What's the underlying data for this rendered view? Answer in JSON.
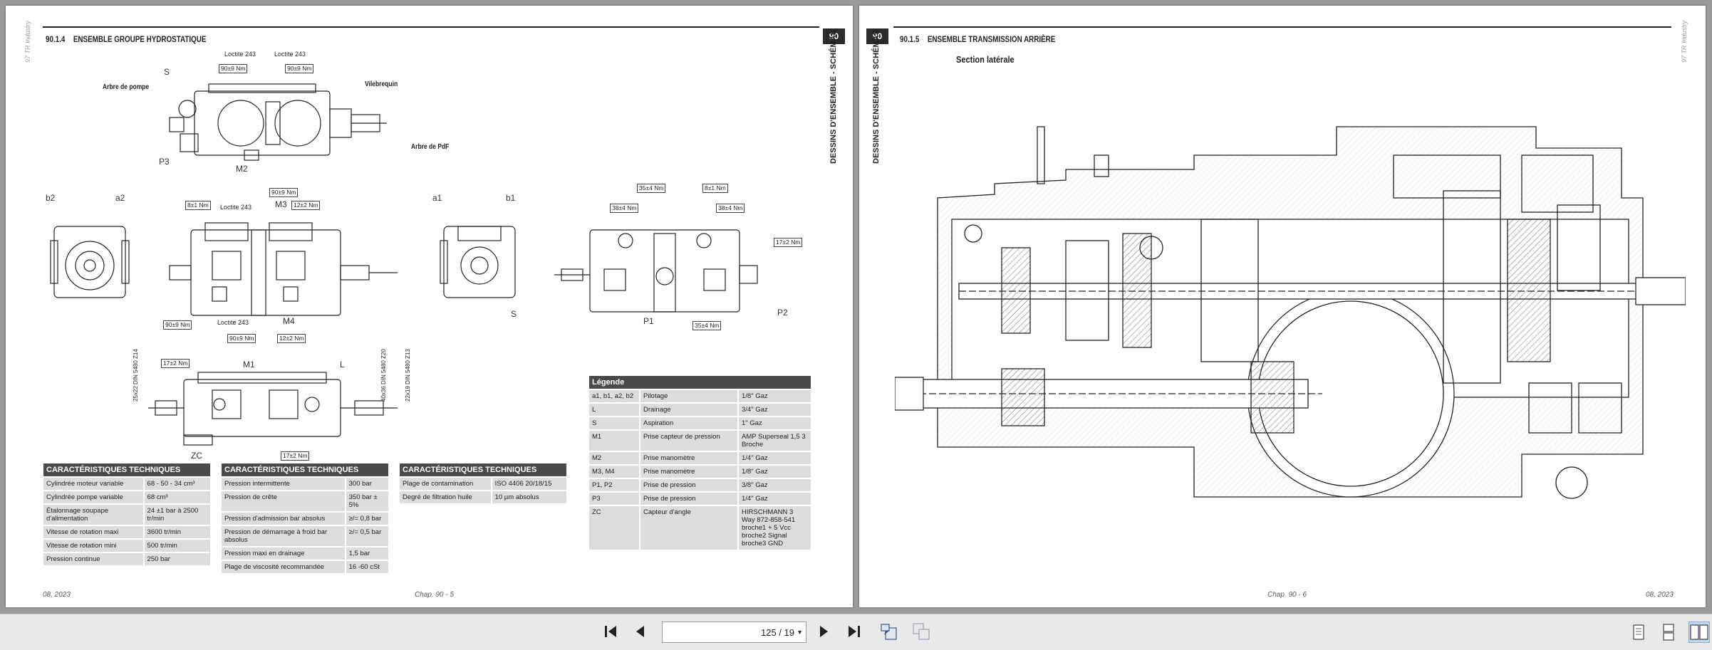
{
  "viewer": {
    "page_indicator": "125 / 19",
    "nav": {
      "first": "first-page-icon",
      "prev": "previous-page-icon",
      "next": "next-page-icon",
      "last": "last-page-icon",
      "go_back": "go-back-icon",
      "go_forward": "go-forward-icon"
    },
    "view_modes": [
      "single-page-icon",
      "continuous-page-icon",
      "two-page-icon"
    ],
    "active_view": "two-page-icon"
  },
  "left_page": {
    "section_number": "90.1.4",
    "section_title": "ENSEMBLE GROUPE HYDROSTATIQUE",
    "chapter": "90",
    "side_label": "DESSINS D'ENSEMBLE - SCHÉMAS",
    "edition_label": "97 TR Industry",
    "footer_date": "08, 2023",
    "footer_chap": "Chap. 90 - 5",
    "callouts": {
      "loctite_1": "Loctite 243",
      "loctite_2": "Loctite 243",
      "torque_90_a": "90±9 Nm",
      "torque_90_b": "90±9 Nm",
      "arbre_pompe": "Arbre de pompe",
      "vilebrequin": "Vilebrequin",
      "arbre_pdf": "Arbre de PdF",
      "s_top": "S",
      "p3": "P3",
      "m2": "M2",
      "b2": "b2",
      "a2": "a2",
      "a1": "a1",
      "b1": "b1",
      "torque_8": "8±1 Nm",
      "loctite_3": "Loctite 243",
      "m3": "M3",
      "torque_90_c": "90±9 Nm",
      "torque_12_a": "12±2 Nm",
      "torque_90_d": "90±9 Nm",
      "loctite_4": "Loctite 243",
      "torque_90_e": "90±9 Nm",
      "m4": "M4",
      "torque_12_b": "12±2 Nm",
      "s_mid": "S",
      "torque_35_a": "35±4 Nm",
      "torque_8_b": "8±1 Nm",
      "torque_38_a": "38±4 Nm",
      "torque_38_b": "38±4 Nm",
      "torque_17_a": "17±2 Nm",
      "p1": "P1",
      "p2": "P2",
      "torque_35_b": "35±4 Nm",
      "torque_17_b": "17±2 Nm",
      "m1": "M1",
      "l": "L",
      "zc": "ZC",
      "torque_17_c": "17±2 Nm",
      "din_left_1": "25x22 DIN 5480 Z14",
      "din_right_1": "40x36 DIN 5480 Z20",
      "din_right_2": "22x19 DIN 5480 Z13"
    },
    "tables": {
      "t1": {
        "header": "CARACTÉRISTIQUES TECHNIQUES",
        "rows": [
          [
            "Cylindrée moteur variable",
            "68 - 50 - 34  cm³"
          ],
          [
            "Cylindrée pompe variable",
            "68 cm³"
          ],
          [
            "Étalonnage soupape d'alimentation",
            "24 ±1 bar à 2500 tr/min"
          ],
          [
            "Vitesse de rotation maxi",
            "3600 tr/min"
          ],
          [
            "Vitesse de rotation mini",
            "500 tr/min"
          ],
          [
            "Pression continue",
            "250 bar"
          ]
        ]
      },
      "t2": {
        "header": "CARACTÉRISTIQUES TECHNIQUES",
        "rows": [
          [
            "Pression intermittente",
            "300 bar"
          ],
          [
            "Pression de crête",
            "350 bar ± 5%"
          ],
          [
            "Pression d'admission bar absolus",
            "≥/= 0,8 bar"
          ],
          [
            "Pression de démarrage à froid bar absolus",
            "≥/= 0,5 bar"
          ],
          [
            "Pression maxi en drainage",
            "1,5 bar"
          ],
          [
            "Plage de viscosité recommandée",
            "16 -60 cSt"
          ]
        ]
      },
      "t3": {
        "header": "CARACTÉRISTIQUES TECHNIQUES",
        "rows": [
          [
            "Plage de contamination",
            "ISO 4406 20/18/15"
          ],
          [
            "Degré de filtration huile",
            "10 µm absolus"
          ]
        ]
      },
      "legend": {
        "header": "Légende",
        "rows": [
          [
            "a1, b1, a2, b2",
            "Pilotage",
            "1/8\" Gaz"
          ],
          [
            "L",
            "Drainage",
            "3/4\" Gaz"
          ],
          [
            "S",
            "Aspiration",
            "1\" Gaz"
          ],
          [
            "M1",
            "Prise capteur de pression",
            "AMP Superseal 1,5 3 Broche"
          ],
          [
            "M2",
            "Prise manomètre",
            "1/4\" Gaz"
          ],
          [
            "M3, M4",
            "Prise manomètre",
            "1/8\" Gaz"
          ],
          [
            "P1, P2",
            "Prise de pression",
            "3/8\" Gaz"
          ],
          [
            "P3",
            "Prise de pression",
            "1/4\" Gaz"
          ],
          [
            "ZC",
            "Capteur d'angle",
            "HIRSCHMANN 3 Way 872-858-541 broche1 + 5 Vcc broche2 Signal broche3 GND"
          ]
        ]
      }
    }
  },
  "right_page": {
    "section_number": "90.1.5",
    "section_title": "ENSEMBLE TRANSMISSION ARRIÈRE",
    "chapter": "90",
    "side_label": "DESSINS D'ENSEMBLE - SCHÉMAS",
    "edition_label": "97 TR Industry",
    "subheading": "Section latérale",
    "footer_chap": "Chap. 90 - 6",
    "footer_date": "08, 2023"
  }
}
